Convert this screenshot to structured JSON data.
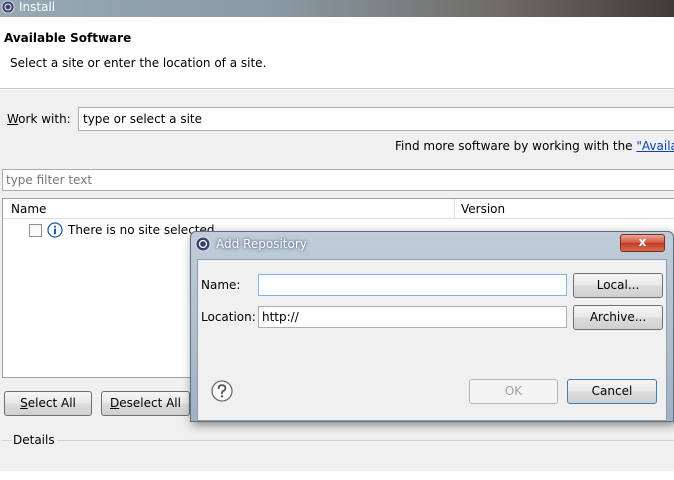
{
  "window": {
    "title": "Install"
  },
  "header": {
    "title": "Available Software",
    "description": "Select a site or enter the location of a site."
  },
  "work_with": {
    "label_key": "W",
    "label_rest": "ork with:",
    "value": "type or select a site"
  },
  "find_more": {
    "prefix": "Find more software by working with the ",
    "link": "\"Availab"
  },
  "filter": {
    "placeholder": "type filter text"
  },
  "table": {
    "columns": [
      "Name",
      "Version"
    ],
    "rows": [
      {
        "text": "There is no site selected"
      }
    ]
  },
  "buttons": {
    "select_all_key": "S",
    "select_all_rest": "elect All",
    "deselect_all_key": "D",
    "deselect_all_rest": "eselect All"
  },
  "details": {
    "label": "Details"
  },
  "dialog": {
    "title": "Add Repository",
    "close_glyph": "x",
    "name_label": "Name:",
    "name_value": "",
    "local_label": "Local...",
    "location_label": "Location:",
    "location_value": "http://",
    "archive_label": "Archive...",
    "ok_label": "OK",
    "cancel_label": "Cancel"
  },
  "colors": {
    "link": "#0645ad",
    "close_button": "#c03a24",
    "focus_border": "#7eb4ea"
  },
  "icons": [
    "eclipse-app-icon",
    "info-icon",
    "help-icon",
    "close-icon"
  ]
}
